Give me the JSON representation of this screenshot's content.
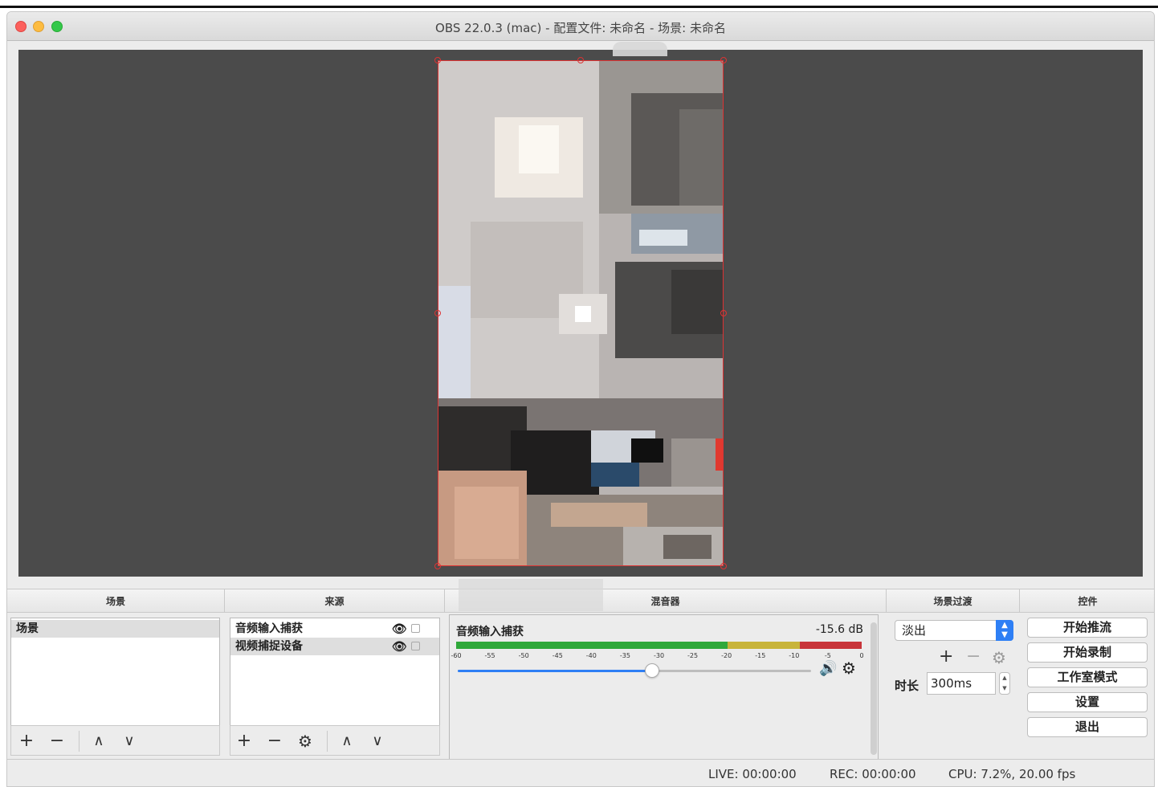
{
  "window": {
    "title": "OBS 22.0.3 (mac) - 配置文件: 未命名 - 场景: 未命名"
  },
  "panels": {
    "scenes_header": "场景",
    "sources_header": "来源",
    "mixer_header": "混音器",
    "transitions_header": "场景过渡",
    "controls_header": "控件"
  },
  "scenes": {
    "items": [
      {
        "label": "场景"
      }
    ]
  },
  "sources": {
    "items": [
      {
        "label": "音频输入捕获"
      },
      {
        "label": "视频捕捉设备"
      }
    ]
  },
  "mixer": {
    "channel_name": "音频输入捕获",
    "db_value": "-15.6 dB",
    "volume_fraction": 0.55,
    "ticks": [
      "-60",
      "-55",
      "-50",
      "-45",
      "-40",
      "-35",
      "-30",
      "-25",
      "-20",
      "-15",
      "-10",
      "-5",
      "0"
    ]
  },
  "transitions": {
    "selected": "淡出",
    "duration_label": "时长",
    "duration_value": "300ms"
  },
  "controls": {
    "start_streaming": "开始推流",
    "start_recording": "开始录制",
    "studio_mode": "工作室模式",
    "settings": "设置",
    "exit": "退出"
  },
  "status": {
    "live": "LIVE: 00:00:00",
    "rec": "REC: 00:00:00",
    "cpu": "CPU: 7.2%, 20.00 fps"
  },
  "colors": {
    "preview_bg": "#4b4b4b",
    "selection_border": "#dd3333",
    "accent_blue": "#2e7ff5",
    "meter_green": "#2fa83a",
    "meter_yellow": "#c8b43a",
    "meter_red": "#c8343a"
  }
}
